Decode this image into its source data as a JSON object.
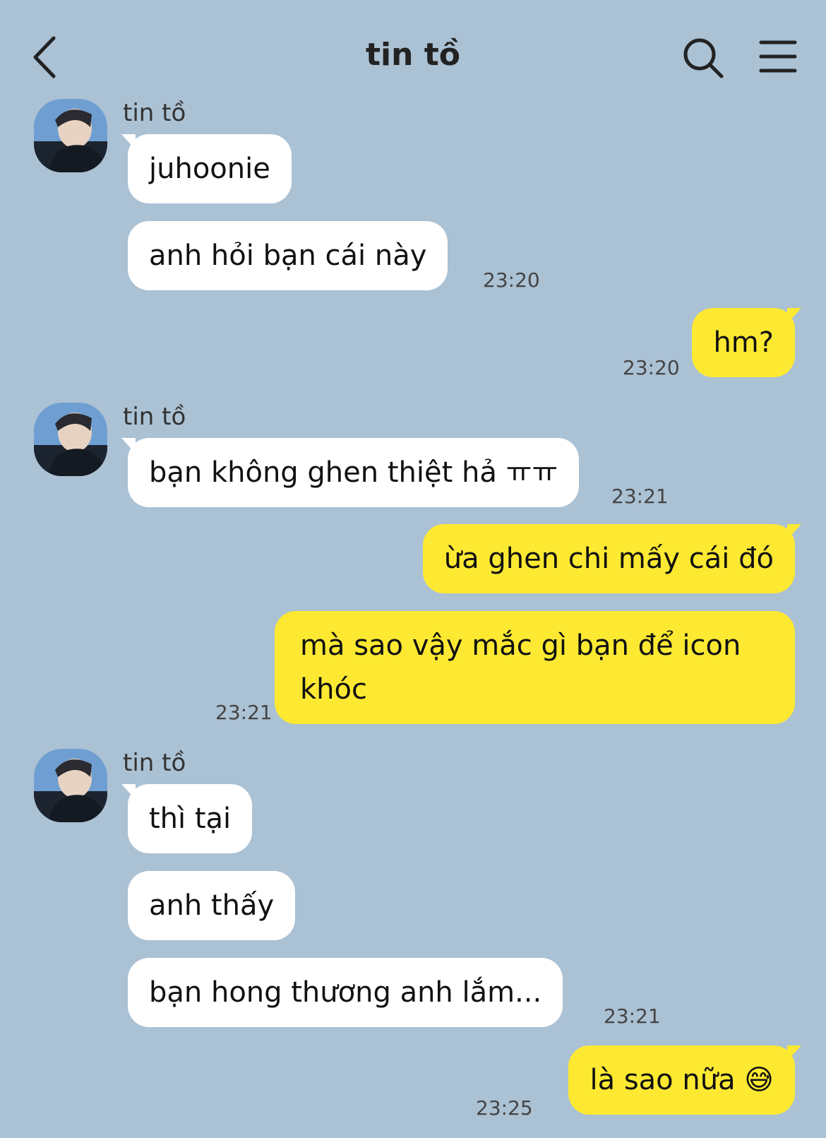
{
  "header": {
    "title": "tin tồ"
  },
  "icons": {
    "back": "chevron-left-icon",
    "search": "search-icon",
    "menu": "menu-icon"
  },
  "colors": {
    "background": "#abc1d4",
    "incoming_bubble": "#ffffff",
    "outgoing_bubble": "#fde932"
  },
  "groups": [
    {
      "sender": "tin tồ",
      "messages": [
        {
          "text": "juhoonie"
        },
        {
          "text": "anh hỏi bạn cái này",
          "time": "23:20"
        }
      ]
    },
    {
      "outgoing": [
        {
          "text": "hm?",
          "time": "23:20"
        }
      ]
    },
    {
      "sender": "tin tồ",
      "messages": [
        {
          "text": "bạn không ghen thiệt hả ㅠㅠ",
          "time": "23:21"
        }
      ]
    },
    {
      "outgoing": [
        {
          "text": "ừa ghen chi mấy cái đó"
        },
        {
          "text": "mà sao vậy mắc gì bạn để icon khóc",
          "time": "23:21"
        }
      ]
    },
    {
      "sender": "tin tồ",
      "messages": [
        {
          "text": "thì tại"
        },
        {
          "text": "anh thấy"
        },
        {
          "text": "bạn hong thương anh lắm...",
          "time": "23:21"
        }
      ]
    },
    {
      "outgoing": [
        {
          "text": "là sao nữa 😅",
          "time": "23:25"
        }
      ]
    }
  ]
}
